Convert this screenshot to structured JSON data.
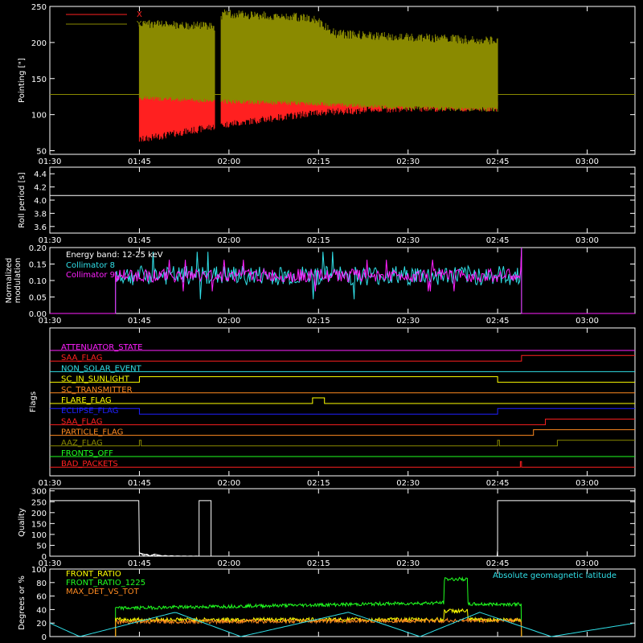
{
  "time_ticks": [
    "01:30",
    "01:45",
    "02:00",
    "02:15",
    "02:30",
    "02:45",
    "03:00"
  ],
  "colors": {
    "x": "#ff2020",
    "y": "#8a8a00",
    "white": "#ffffff",
    "cyan": "#30e0e8",
    "magenta": "#ff20ff",
    "orange": "#ff8a20",
    "green": "#20ff20"
  },
  "chart_data": [
    {
      "id": "pointing",
      "type": "line",
      "ylabel": "Pointing [\"]",
      "ylim": [
        45,
        250
      ],
      "yticks": [
        50,
        100,
        150,
        200,
        250
      ],
      "legend": [
        {
          "name": "X",
          "color": "#ff2020"
        },
        {
          "name": "Y",
          "color": "#8a8a00"
        }
      ],
      "reference_line": 128,
      "series": [
        {
          "name": "Y upper envelope",
          "color": "#8a8a00",
          "x": [
            "01:45",
            "01:46",
            "01:58",
            "01:59",
            "02:14",
            "02:18",
            "02:45"
          ],
          "values": [
            230,
            232,
            228,
            246,
            240,
            218,
            208
          ]
        },
        {
          "name": "Y lower envelope",
          "color": "#8a8a00",
          "x": [
            "01:45",
            "02:00",
            "02:15",
            "02:30",
            "02:45"
          ],
          "values": [
            120,
            115,
            112,
            106,
            104
          ]
        },
        {
          "name": "X upper envelope",
          "color": "#ff2020",
          "x": [
            "01:45",
            "02:00",
            "02:15",
            "02:30",
            "02:45"
          ],
          "values": [
            130,
            128,
            124,
            120,
            118
          ]
        },
        {
          "name": "X lower envelope",
          "color": "#ff2020",
          "x": [
            "01:45",
            "02:00",
            "02:15",
            "02:30",
            "02:45"
          ],
          "values": [
            60,
            82,
            98,
            104,
            104
          ]
        }
      ]
    },
    {
      "id": "roll",
      "type": "line",
      "ylabel": "Roll period [s]",
      "ylim": [
        3.5,
        4.5
      ],
      "yticks": [
        3.6,
        3.8,
        4.0,
        4.2,
        4.4
      ],
      "series": [
        {
          "name": "",
          "color": "#ffffff",
          "x": [
            "01:30",
            "03:08"
          ],
          "values": [
            4.07,
            4.07
          ]
        }
      ]
    },
    {
      "id": "modulation",
      "type": "line",
      "ylabel": [
        "Normalized",
        "modulation"
      ],
      "ylim": [
        0,
        0.2
      ],
      "yticks": [
        0.0,
        0.05,
        0.1,
        0.15,
        0.2
      ],
      "annotation": "Energy band: 12-25 keV",
      "legend": [
        {
          "name": "Collimator 8",
          "color": "#30e0e8"
        },
        {
          "name": "Collimator 9",
          "color": "#ff20ff"
        }
      ],
      "series": [
        {
          "name": "Collimator 8",
          "color": "#30e0e8",
          "start": "01:41",
          "end": "02:49",
          "mean": 0.115,
          "spread": 0.03
        },
        {
          "name": "Collimator 9",
          "color": "#ff20ff",
          "start": "01:41",
          "end": "02:49",
          "mean": 0.115,
          "spread": 0.02
        }
      ]
    },
    {
      "id": "flags",
      "type": "line",
      "ylabel": "Flags",
      "flags": [
        {
          "name": "ATTENUATOR_STATE",
          "color": "#ff20ff",
          "steps": [
            [
              "01:30",
              0
            ]
          ]
        },
        {
          "name": "SAA_FLAG",
          "color": "#ff2020",
          "steps": [
            [
              "01:30",
              0
            ],
            [
              "02:49",
              1
            ]
          ]
        },
        {
          "name": "NON_SOLAR_EVENT",
          "color": "#30e0e8",
          "steps": [
            [
              "01:30",
              0
            ]
          ]
        },
        {
          "name": "SC_IN_SUNLIGHT",
          "color": "#ffff00",
          "steps": [
            [
              "01:30",
              0
            ],
            [
              "01:45",
              1
            ],
            [
              "02:45",
              0
            ]
          ]
        },
        {
          "name": "SC_TRANSMITTER",
          "color": "#ff8a20",
          "steps": [
            [
              "01:30",
              0
            ]
          ]
        },
        {
          "name": "FLARE_FLAG",
          "color": "#ffff00",
          "steps": [
            [
              "01:30",
              0
            ],
            [
              "02:14",
              1
            ],
            [
              "02:16",
              0
            ]
          ]
        },
        {
          "name": "ECLIPSE_FLAG",
          "color": "#2020ff",
          "steps": [
            [
              "01:30",
              1
            ],
            [
              "01:45",
              0
            ],
            [
              "02:45",
              1
            ]
          ]
        },
        {
          "name": "SAA_FLAG",
          "color": "#ff2020",
          "steps": [
            [
              "01:30",
              0
            ],
            [
              "02:53",
              1
            ]
          ]
        },
        {
          "name": "PARTICLE_FLAG",
          "color": "#ff8a20",
          "steps": [
            [
              "01:30",
              0
            ],
            [
              "02:51",
              1
            ]
          ]
        },
        {
          "name": "AAZ_FLAG",
          "color": "#8a8a00",
          "steps": [
            [
              "01:30",
              0
            ],
            [
              "01:45",
              1
            ],
            [
              "01:45.3",
              0
            ],
            [
              "02:45",
              1
            ],
            [
              "02:45.3",
              0
            ],
            [
              "02:55",
              1
            ]
          ]
        },
        {
          "name": "FRONTS_OFF",
          "color": "#20ff20",
          "steps": [
            [
              "01:30",
              0
            ]
          ]
        },
        {
          "name": "BAD_PACKETS",
          "color": "#ff2020",
          "steps": [
            [
              "01:30",
              0
            ],
            [
              "02:48.8",
              1
            ],
            [
              "02:49",
              0
            ]
          ]
        }
      ]
    },
    {
      "id": "quality",
      "type": "line",
      "ylabel": "Quality",
      "ylim": [
        0,
        310
      ],
      "yticks": [
        0,
        50,
        100,
        150,
        200,
        250,
        300
      ],
      "series": [
        {
          "name": "",
          "color": "#ffffff",
          "x": [
            "01:30",
            "01:44.9",
            "01:45",
            "01:47",
            "01:47.5",
            "01:49",
            "01:55",
            "01:55",
            "01:57",
            "01:57",
            "02:10",
            "02:44.9",
            "02:45",
            "02:45",
            "03:08"
          ],
          "values": [
            255,
            255,
            15,
            0,
            10,
            0,
            0,
            255,
            255,
            0,
            0,
            0,
            30,
            255,
            255
          ]
        }
      ]
    },
    {
      "id": "ratios",
      "type": "line",
      "ylabel": "Degrees or %",
      "ylim": [
        0,
        100
      ],
      "yticks": [
        0,
        20,
        40,
        60,
        80,
        100
      ],
      "legend": [
        {
          "name": "FRONT_RATIO",
          "color": "#ffff00"
        },
        {
          "name": "FRONT_RATIO_1225",
          "color": "#20ff20"
        },
        {
          "name": "MAX_DET_VS_TOT",
          "color": "#ff8a20"
        }
      ],
      "annotation_right": "Absolute geomagnetic latitude",
      "annotation_right_color": "#30e0e8",
      "series": [
        {
          "name": "FRONT_RATIO_1225",
          "color": "#20ff20",
          "x": [
            "01:41",
            "02:36",
            "02:36",
            "02:40",
            "02:40",
            "02:49"
          ],
          "values": [
            42,
            50,
            85,
            85,
            48,
            48
          ]
        },
        {
          "name": "FRONT_RATIO",
          "color": "#ffff00",
          "x": [
            "01:41",
            "02:36",
            "02:36",
            "02:40",
            "02:40",
            "02:49"
          ],
          "values": [
            25,
            25,
            38,
            38,
            25,
            25
          ]
        },
        {
          "name": "MAX_DET_VS_TOT",
          "color": "#ff8a20",
          "x": [
            "01:41",
            "02:49"
          ],
          "values": [
            22,
            24
          ]
        },
        {
          "name": "Absolute geomagnetic latitude",
          "color": "#30e0e8",
          "x": [
            "01:30",
            "01:35",
            "01:51",
            "02:02",
            "02:20",
            "02:32",
            "02:42",
            "02:54",
            "03:08"
          ],
          "values": [
            20,
            0,
            36,
            0,
            36,
            0,
            36,
            0,
            20
          ]
        }
      ]
    }
  ]
}
